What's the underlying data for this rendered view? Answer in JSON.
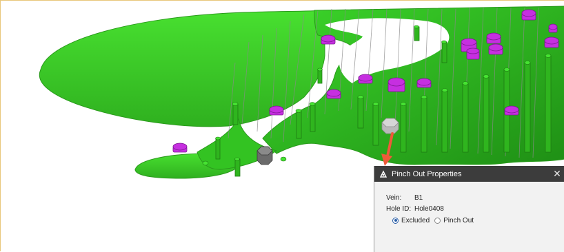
{
  "dialog": {
    "title": "Pinch Out Properties",
    "vein_label": "Vein:",
    "vein_value": "B1",
    "hole_label": "Hole ID:",
    "hole_value": "Hole0408",
    "options": [
      {
        "label": "Excluded",
        "selected": true
      },
      {
        "label": "Pinch Out",
        "selected": false
      }
    ]
  },
  "colors": {
    "surface": "#3fd12a",
    "drillhole_marker": "#c62fe0",
    "selected_marker": "#6b6b6b",
    "arrow": "#ee5a3a",
    "titlebar": "#3c3c3c"
  },
  "icons": [
    "app-icon",
    "close-icon",
    "arrow-annotation"
  ]
}
